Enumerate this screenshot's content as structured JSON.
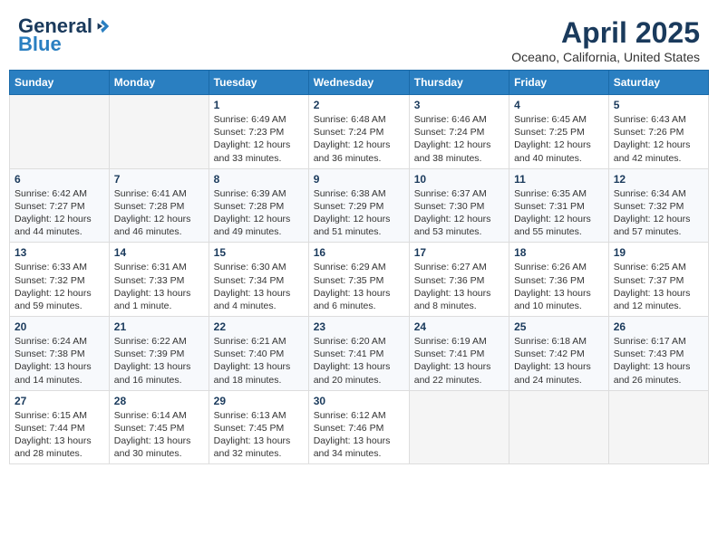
{
  "header": {
    "logo_general": "General",
    "logo_blue": "Blue",
    "month": "April 2025",
    "location": "Oceano, California, United States"
  },
  "weekdays": [
    "Sunday",
    "Monday",
    "Tuesday",
    "Wednesday",
    "Thursday",
    "Friday",
    "Saturday"
  ],
  "weeks": [
    [
      {
        "day": "",
        "sunrise": "",
        "sunset": "",
        "daylight": ""
      },
      {
        "day": "",
        "sunrise": "",
        "sunset": "",
        "daylight": ""
      },
      {
        "day": "1",
        "sunrise": "Sunrise: 6:49 AM",
        "sunset": "Sunset: 7:23 PM",
        "daylight": "Daylight: 12 hours and 33 minutes."
      },
      {
        "day": "2",
        "sunrise": "Sunrise: 6:48 AM",
        "sunset": "Sunset: 7:24 PM",
        "daylight": "Daylight: 12 hours and 36 minutes."
      },
      {
        "day": "3",
        "sunrise": "Sunrise: 6:46 AM",
        "sunset": "Sunset: 7:24 PM",
        "daylight": "Daylight: 12 hours and 38 minutes."
      },
      {
        "day": "4",
        "sunrise": "Sunrise: 6:45 AM",
        "sunset": "Sunset: 7:25 PM",
        "daylight": "Daylight: 12 hours and 40 minutes."
      },
      {
        "day": "5",
        "sunrise": "Sunrise: 6:43 AM",
        "sunset": "Sunset: 7:26 PM",
        "daylight": "Daylight: 12 hours and 42 minutes."
      }
    ],
    [
      {
        "day": "6",
        "sunrise": "Sunrise: 6:42 AM",
        "sunset": "Sunset: 7:27 PM",
        "daylight": "Daylight: 12 hours and 44 minutes."
      },
      {
        "day": "7",
        "sunrise": "Sunrise: 6:41 AM",
        "sunset": "Sunset: 7:28 PM",
        "daylight": "Daylight: 12 hours and 46 minutes."
      },
      {
        "day": "8",
        "sunrise": "Sunrise: 6:39 AM",
        "sunset": "Sunset: 7:28 PM",
        "daylight": "Daylight: 12 hours and 49 minutes."
      },
      {
        "day": "9",
        "sunrise": "Sunrise: 6:38 AM",
        "sunset": "Sunset: 7:29 PM",
        "daylight": "Daylight: 12 hours and 51 minutes."
      },
      {
        "day": "10",
        "sunrise": "Sunrise: 6:37 AM",
        "sunset": "Sunset: 7:30 PM",
        "daylight": "Daylight: 12 hours and 53 minutes."
      },
      {
        "day": "11",
        "sunrise": "Sunrise: 6:35 AM",
        "sunset": "Sunset: 7:31 PM",
        "daylight": "Daylight: 12 hours and 55 minutes."
      },
      {
        "day": "12",
        "sunrise": "Sunrise: 6:34 AM",
        "sunset": "Sunset: 7:32 PM",
        "daylight": "Daylight: 12 hours and 57 minutes."
      }
    ],
    [
      {
        "day": "13",
        "sunrise": "Sunrise: 6:33 AM",
        "sunset": "Sunset: 7:32 PM",
        "daylight": "Daylight: 12 hours and 59 minutes."
      },
      {
        "day": "14",
        "sunrise": "Sunrise: 6:31 AM",
        "sunset": "Sunset: 7:33 PM",
        "daylight": "Daylight: 13 hours and 1 minute."
      },
      {
        "day": "15",
        "sunrise": "Sunrise: 6:30 AM",
        "sunset": "Sunset: 7:34 PM",
        "daylight": "Daylight: 13 hours and 4 minutes."
      },
      {
        "day": "16",
        "sunrise": "Sunrise: 6:29 AM",
        "sunset": "Sunset: 7:35 PM",
        "daylight": "Daylight: 13 hours and 6 minutes."
      },
      {
        "day": "17",
        "sunrise": "Sunrise: 6:27 AM",
        "sunset": "Sunset: 7:36 PM",
        "daylight": "Daylight: 13 hours and 8 minutes."
      },
      {
        "day": "18",
        "sunrise": "Sunrise: 6:26 AM",
        "sunset": "Sunset: 7:36 PM",
        "daylight": "Daylight: 13 hours and 10 minutes."
      },
      {
        "day": "19",
        "sunrise": "Sunrise: 6:25 AM",
        "sunset": "Sunset: 7:37 PM",
        "daylight": "Daylight: 13 hours and 12 minutes."
      }
    ],
    [
      {
        "day": "20",
        "sunrise": "Sunrise: 6:24 AM",
        "sunset": "Sunset: 7:38 PM",
        "daylight": "Daylight: 13 hours and 14 minutes."
      },
      {
        "day": "21",
        "sunrise": "Sunrise: 6:22 AM",
        "sunset": "Sunset: 7:39 PM",
        "daylight": "Daylight: 13 hours and 16 minutes."
      },
      {
        "day": "22",
        "sunrise": "Sunrise: 6:21 AM",
        "sunset": "Sunset: 7:40 PM",
        "daylight": "Daylight: 13 hours and 18 minutes."
      },
      {
        "day": "23",
        "sunrise": "Sunrise: 6:20 AM",
        "sunset": "Sunset: 7:41 PM",
        "daylight": "Daylight: 13 hours and 20 minutes."
      },
      {
        "day": "24",
        "sunrise": "Sunrise: 6:19 AM",
        "sunset": "Sunset: 7:41 PM",
        "daylight": "Daylight: 13 hours and 22 minutes."
      },
      {
        "day": "25",
        "sunrise": "Sunrise: 6:18 AM",
        "sunset": "Sunset: 7:42 PM",
        "daylight": "Daylight: 13 hours and 24 minutes."
      },
      {
        "day": "26",
        "sunrise": "Sunrise: 6:17 AM",
        "sunset": "Sunset: 7:43 PM",
        "daylight": "Daylight: 13 hours and 26 minutes."
      }
    ],
    [
      {
        "day": "27",
        "sunrise": "Sunrise: 6:15 AM",
        "sunset": "Sunset: 7:44 PM",
        "daylight": "Daylight: 13 hours and 28 minutes."
      },
      {
        "day": "28",
        "sunrise": "Sunrise: 6:14 AM",
        "sunset": "Sunset: 7:45 PM",
        "daylight": "Daylight: 13 hours and 30 minutes."
      },
      {
        "day": "29",
        "sunrise": "Sunrise: 6:13 AM",
        "sunset": "Sunset: 7:45 PM",
        "daylight": "Daylight: 13 hours and 32 minutes."
      },
      {
        "day": "30",
        "sunrise": "Sunrise: 6:12 AM",
        "sunset": "Sunset: 7:46 PM",
        "daylight": "Daylight: 13 hours and 34 minutes."
      },
      {
        "day": "",
        "sunrise": "",
        "sunset": "",
        "daylight": ""
      },
      {
        "day": "",
        "sunrise": "",
        "sunset": "",
        "daylight": ""
      },
      {
        "day": "",
        "sunrise": "",
        "sunset": "",
        "daylight": ""
      }
    ]
  ]
}
